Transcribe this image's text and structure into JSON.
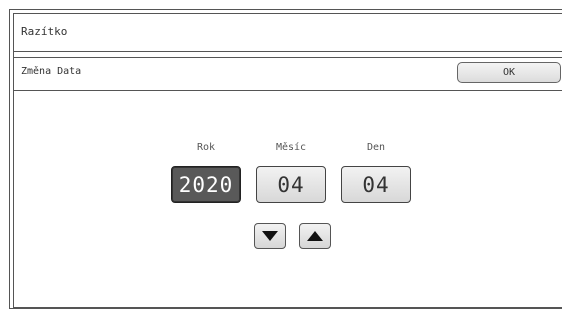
{
  "window": {
    "title": "Razítko"
  },
  "panel": {
    "title": "Změna Data",
    "ok_label": "OK"
  },
  "date": {
    "year": {
      "label": "Rok",
      "value": "2020",
      "selected": true
    },
    "month": {
      "label": "Měsíc",
      "value": "04",
      "selected": false
    },
    "day": {
      "label": "Den",
      "value": "04",
      "selected": false
    }
  },
  "controls": {
    "decrement_icon": "triangle-down-icon",
    "increment_icon": "triangle-up-icon"
  },
  "colors": {
    "selected_field_bg": "#595959",
    "field_bg": "#e6e6e6",
    "border": "#555555"
  }
}
